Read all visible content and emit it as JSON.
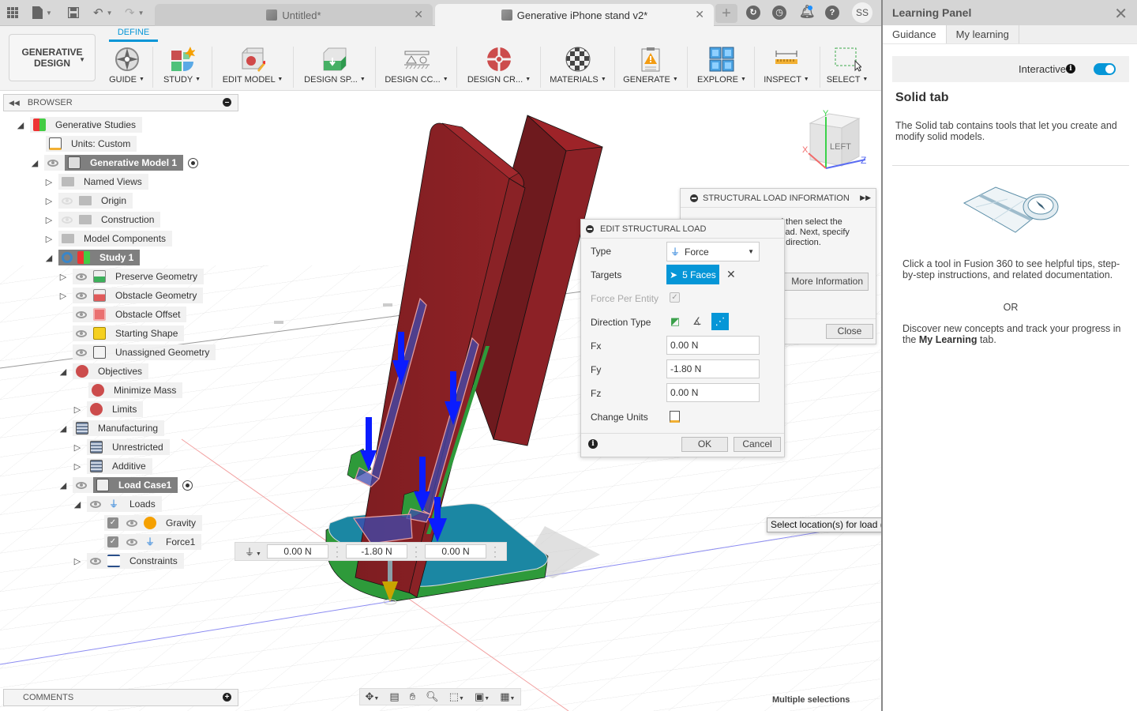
{
  "titlebar": {
    "tabs": [
      {
        "label": "Untitled*",
        "active": false
      },
      {
        "label": "Generative iPhone stand v2*",
        "active": true
      }
    ],
    "user_initials": "SS",
    "icons": [
      "grid-icon",
      "file-icon",
      "save-icon",
      "undo-icon",
      "redo-icon",
      "new-tab-icon",
      "extensions-icon",
      "job-status-icon",
      "notifications-icon",
      "help-icon"
    ]
  },
  "ribbon": {
    "workspace": "GENERATIVE DESIGN",
    "workspace_line1": "GENERATIVE",
    "workspace_line2": "DESIGN",
    "active_tab": "DEFINE",
    "groups": [
      {
        "label": "GUIDE",
        "icon": "compass-icon"
      },
      {
        "label": "STUDY",
        "icon": "study-icon"
      },
      {
        "label": "EDIT MODEL",
        "icon": "edit-model-icon"
      },
      {
        "label": "DESIGN SP...",
        "icon": "design-space-icon"
      },
      {
        "label": "DESIGN CC...",
        "icon": "design-conditions-icon"
      },
      {
        "label": "DESIGN CR...",
        "icon": "design-criteria-icon"
      },
      {
        "label": "MATERIALS",
        "icon": "materials-icon"
      },
      {
        "label": "GENERATE",
        "icon": "generate-icon"
      },
      {
        "label": "EXPLORE",
        "icon": "explore-icon"
      },
      {
        "label": "INSPECT",
        "icon": "inspect-icon"
      },
      {
        "label": "SELECT",
        "icon": "select-icon"
      }
    ]
  },
  "browser": {
    "title": "BROWSER",
    "items": [
      {
        "label": "Generative Studies"
      },
      {
        "label": "Units: Custom"
      },
      {
        "label": "Generative Model 1"
      },
      {
        "label": "Named Views"
      },
      {
        "label": "Origin"
      },
      {
        "label": "Construction"
      },
      {
        "label": "Model Components"
      },
      {
        "label": "Study 1"
      },
      {
        "label": "Preserve Geometry"
      },
      {
        "label": "Obstacle Geometry"
      },
      {
        "label": "Obstacle Offset"
      },
      {
        "label": "Starting Shape"
      },
      {
        "label": "Unassigned Geometry"
      },
      {
        "label": "Objectives"
      },
      {
        "label": "Minimize Mass"
      },
      {
        "label": "Limits"
      },
      {
        "label": "Manufacturing"
      },
      {
        "label": "Unrestricted"
      },
      {
        "label": "Additive"
      },
      {
        "label": "Load Case1"
      },
      {
        "label": "Loads"
      },
      {
        "label": "Gravity",
        "checked": true
      },
      {
        "label": "Force1",
        "checked": true
      },
      {
        "label": "Constraints"
      }
    ]
  },
  "comments": {
    "title": "COMMENTS"
  },
  "manipulator": {
    "fx": "0.00 N",
    "fy": "-1.80 N",
    "fz": "0.00 N"
  },
  "viewcube": {
    "face": "LEFT",
    "axes": [
      "X",
      "Y",
      "Z"
    ]
  },
  "structural_load_info": {
    "title": "STRUCTURAL LOAD INFORMATION",
    "text_line1": "Select a load type and then select the",
    "text_line2": "target faces for the load. Next, specify",
    "text_line3": "the magnitude and direction.",
    "visible_line1": "d then select the",
    "visible_line2": "load. Next, specify",
    "visible_line3": "d direction.",
    "more_button": "More Information",
    "close_button": "Close"
  },
  "edit_structural_load": {
    "title": "EDIT STRUCTURAL LOAD",
    "type_label": "Type",
    "type_value": "Force",
    "targets_label": "Targets",
    "targets_value": "5 Faces",
    "force_per_entity_label": "Force Per Entity",
    "force_per_entity_checked": true,
    "direction_type_label": "Direction Type",
    "direction_type_selected": "vector-components",
    "fx_label": "Fx",
    "fx_value": "0.00 N",
    "fy_label": "Fy",
    "fy_value": "-1.80 N",
    "fz_label": "Fz",
    "fz_value": "0.00 N",
    "change_units_label": "Change Units",
    "ok_button": "OK",
    "cancel_button": "Cancel"
  },
  "tooltip": "Select location(s) for load (only faces).",
  "status": "Multiple selections",
  "learning_panel": {
    "title": "Learning Panel",
    "tabs": [
      {
        "label": "Guidance",
        "active": true
      },
      {
        "label": "My learning",
        "active": false
      }
    ],
    "interactive_label": "Interactive",
    "interactive_on": true,
    "heading": "Solid tab",
    "description": "The Solid tab contains tools that let you create and modify solid models.",
    "para1": "Click a tool in Fusion 360 to see helpful tips, step-by-step instructions, and related documentation.",
    "or": "OR",
    "para2_pre": "Discover new concepts and track your progress in the ",
    "para2_bold": "My Learning",
    "para2_post": " tab."
  },
  "colors": {
    "accent": "#0696d7",
    "model_red": "#8b2025",
    "preserve_green": "#2e9a3a",
    "base_teal": "#1b87a3",
    "load_arrow": "#0a1cff"
  }
}
